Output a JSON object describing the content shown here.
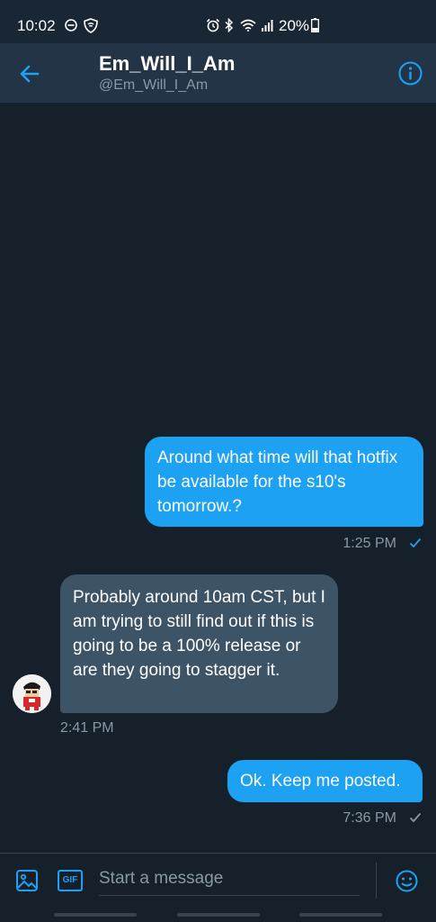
{
  "status_bar": {
    "time": "10:02",
    "battery": "20%"
  },
  "header": {
    "name": "Em_Will_I_Am",
    "handle": "@Em_Will_I_Am"
  },
  "messages": [
    {
      "direction": "outgoing",
      "text": "Around what time will that hotfix be available for the s10's tomorrow.?",
      "time": "1:25 PM"
    },
    {
      "direction": "incoming",
      "text": "Probably around 10am CST, but I am trying to still find out if this is going to be a 100% release or are they going to stagger it.",
      "time": "2:41 PM"
    },
    {
      "direction": "outgoing",
      "text": "Ok. Keep me posted.",
      "time": "7:36 PM"
    }
  ],
  "composer": {
    "placeholder": "Start a message",
    "gif_label": "GIF"
  },
  "colors": {
    "accent": "#1da1f2",
    "background": "#15202b",
    "incoming_bubble": "#3d5466",
    "secondary_text": "#8899a6"
  }
}
